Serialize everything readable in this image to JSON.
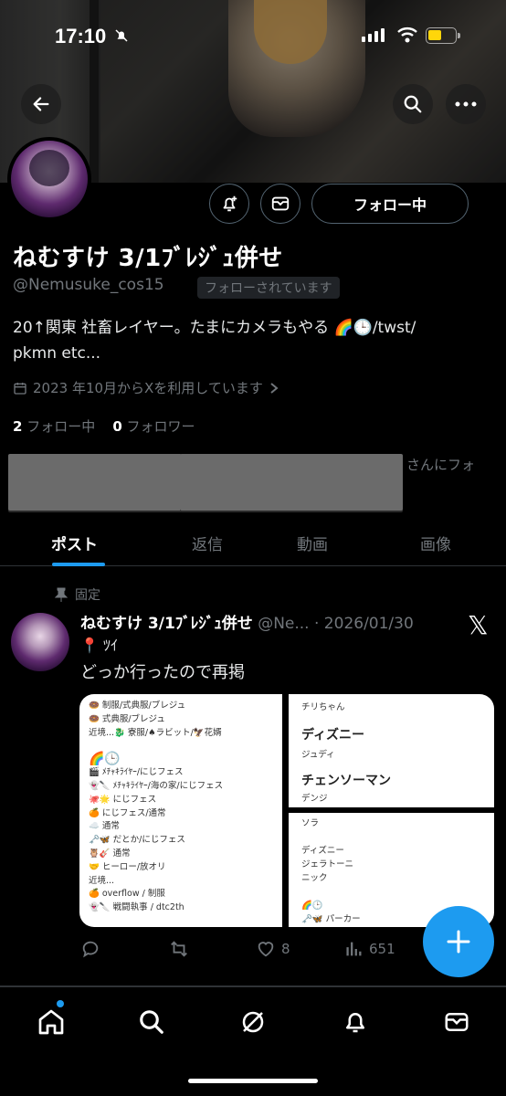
{
  "status_bar": {
    "time": "17:10"
  },
  "profile": {
    "display_name": "ねむすけ 3/1ﾌﾞﾚｼﾞｭ併せ",
    "handle": "@Nemusuke_cos15",
    "follows_you_badge": "フォローされています",
    "follow_button": "フォロー中",
    "bio_line1": "20↑関東 社畜レイヤー。たまにカメラもやる 🌈🕒/twst/",
    "bio_line2": "pkmn etc...",
    "joined": "2023 年10月からXを利用しています",
    "following_count": "2",
    "following_label": "フォロー中",
    "followers_count": "0",
    "followers_label": "フォロワー",
    "mutual_text": "さんにフォ"
  },
  "tabs": [
    {
      "label": "ポスト",
      "active": true
    },
    {
      "label": "返信",
      "active": false
    },
    {
      "label": "動画",
      "active": false
    },
    {
      "label": "画像",
      "active": false
    }
  ],
  "post": {
    "pinned_label": "固定",
    "author_name": "ねむすけ 3/1ﾌﾞﾚｼﾞｭ併せ",
    "author_handle_truncated": "@Ne...",
    "date": "· 2026/01/30",
    "line1": "📍 ﾂｲ",
    "line2": "どっか行ったので再掲",
    "media_left_lines": [
      "🍩 制服/式典服/ブレジュ",
      "🍩 式典服/ブレジュ",
      "近境...🐉 寮服/♠ラビット/🦅花婿",
      "",
      "🌈🕒",
      "🎬 ﾒﾁｬｷﾗｲﾔｰ/にじフェス",
      "👻🔪 ﾒﾁｬｷﾗｲﾔｰ/海の家/にじフェス",
      "🐙🌟 にじフェス",
      "🍊 にじフェス/通常",
      "☁️ 通常",
      "🗝️🦋 だとか/にじフェス",
      "🦉🎸 通常",
      "🤝 ヒーロー/放オリ",
      "近境...",
      "🍊 overflow / 制服",
      "👻🔪 戦闘執事 / dtc2th"
    ],
    "media_right_top": {
      "line1": "チリちゃん",
      "heading1": "ディズニー",
      "line2": "ジュディ",
      "heading2": "チェンソーマン",
      "line3": "デンジ"
    },
    "media_right_bottom_lines": [
      "ソラ",
      "",
      "ディズニー",
      "ジェラトーニ",
      "ニック",
      "",
      "🌈🕒",
      "🗝️🦋 パーカー"
    ],
    "likes": "8",
    "views": "651"
  },
  "colors": {
    "accent": "#1d9bf0",
    "muted": "#71767b",
    "background": "#000000"
  }
}
